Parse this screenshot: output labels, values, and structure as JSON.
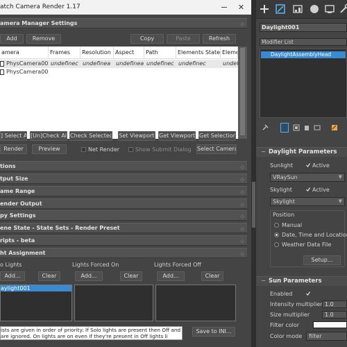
{
  "window": {
    "title": "atch Camera Render 1.17",
    "close_glyph": "✕"
  },
  "camera_manager": {
    "header": "amera Manager Settings",
    "add": "Add",
    "remove": "Remove",
    "copy": "Copy",
    "paste": "Paste",
    "refresh": "Refresh",
    "columns": [
      "amera",
      "Frames",
      "Resolution",
      "Aspect",
      "Path",
      "Elements State",
      "Eleme"
    ],
    "rows": [
      {
        "name": "PhysCamera001",
        "frames": "undefinec",
        "resolution": "undefinea",
        "aspect": "undefinea",
        "path": "undefinec",
        "elements_state": "undefinec",
        "eleme": "undefi"
      },
      {
        "name": "PhysCamera002"
      }
    ],
    "select_all": "] Select All",
    "uncheck_all": "[Un]Check All",
    "check_selected": "Check Selected",
    "set_viewport": "Set Viewport",
    "get_viewport": "Get Viewport",
    "get_selection": "Get Selection",
    "render": "Render",
    "preview": "Preview",
    "net_render": "Net Render",
    "show_submit": "Show Submit Dialog",
    "select_camera": "Select Camera"
  },
  "rollouts": {
    "options": "tions",
    "output_size": "tput Size",
    "frame_range": "ame Range",
    "render_output": "ender Output",
    "copy_settings": "py Settings",
    "scene_state": "ene State - State Sets - Render Preset",
    "scripts": "ripts - beta",
    "light_assignment": "ht Assignment"
  },
  "light_assignment": {
    "solo_label": "o Lights",
    "forced_on_label": "Lights Forced On",
    "forced_off_label": "Lights Forced Off",
    "add": "Add...",
    "clear": "Clear",
    "solo_item": "aylight001",
    "info_line1": "ists are given in order of priority: If Solo lights are present then Off and",
    "info_line2": "are ignored. On lights are on even if they're present in Off lights li",
    "save_to_ini": "Save to INI..."
  },
  "right_panel": {
    "object_name": "Daylight001",
    "modifier_list": "Modifier List",
    "stack_item": "DaylightAssemblyHead",
    "daylight_params": {
      "title": "Daylight Parameters",
      "sunlight_label": "Sunlight",
      "active": "Active",
      "sunlight_value": "VRaySun",
      "skylight_label": "Skylight",
      "skylight_value": "Skylight",
      "position_label": "Position",
      "manual": "Manual",
      "date_time_location": "Date, Time and Location",
      "weather_file": "Weather Data File",
      "setup": "Setup..."
    },
    "sun_params": {
      "title": "Sun Parameters",
      "enabled": "Enabled",
      "intensity_multiplier": "Intensity multiplier",
      "intensity_value": "1.0",
      "size_multiplier": "Size multiplier",
      "size_value": "1.0",
      "filter_color": "Filter color",
      "color_mode": "Color mode",
      "color_mode_value": "filter"
    }
  },
  "colors": {
    "selection_blue": "#3a8ad1",
    "panel_bg": "#444444",
    "titlebar_bg": "#f2f2f2"
  }
}
